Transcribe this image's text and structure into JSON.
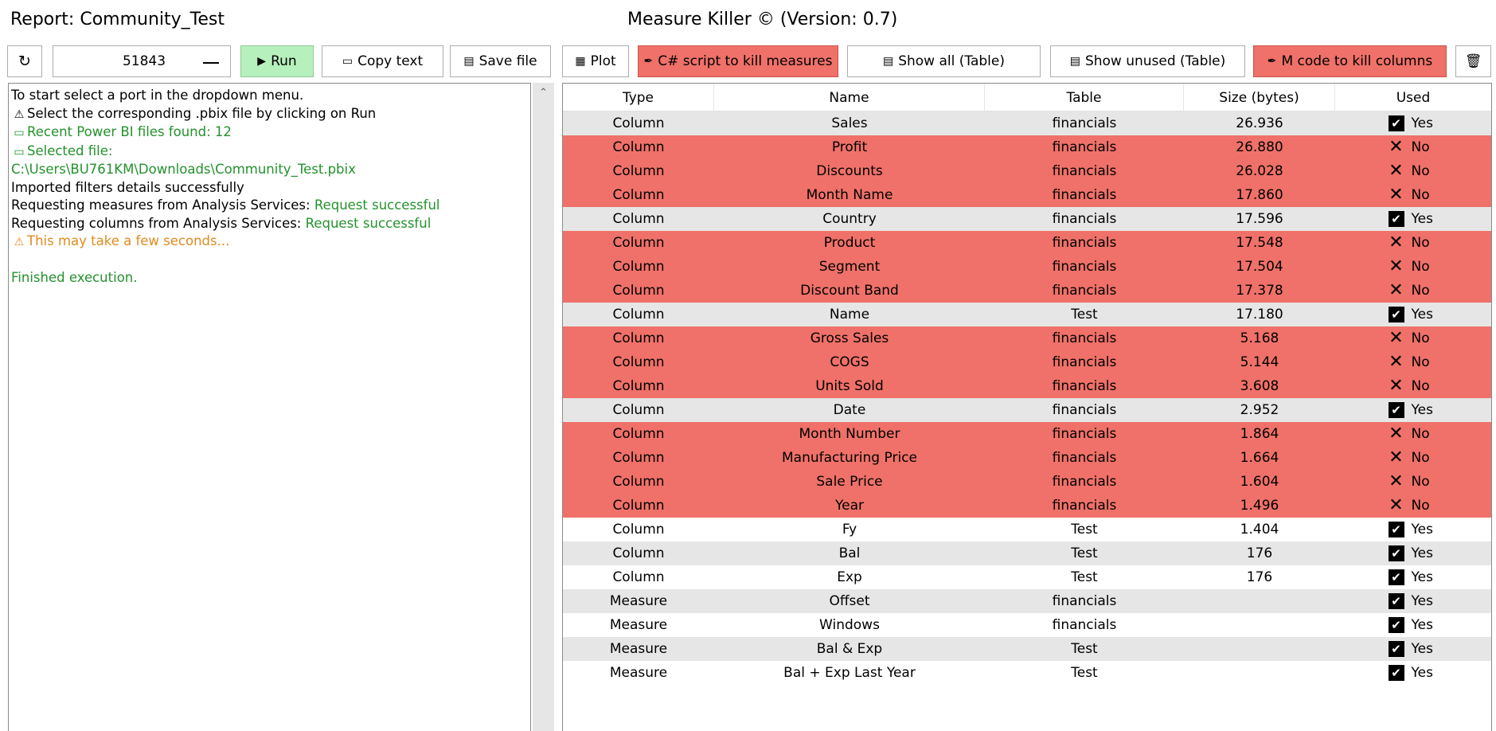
{
  "header": {
    "report_title": "Report: Community_Test",
    "app_title": "Measure Killer © (Version: 0.7)"
  },
  "toolbar": {
    "refresh_icon": "refresh-icon",
    "port_value": "51843",
    "run_label": "Run",
    "copy_label": "Copy text",
    "save_label": "Save file",
    "plot_label": "Plot",
    "csharp_label": "C# script to kill measures",
    "show_all_label": "Show all (Table)",
    "show_unused_label": "Show unused (Table)",
    "mcode_label": "M code to kill columns",
    "trash_icon": "trash-icon",
    "run_color": "#b6f0bc",
    "danger_color": "#ef7169"
  },
  "log": {
    "line1": "To start select a port in the dropdown menu.",
    "line2": "Select the corresponding .pbix file by clicking on Run",
    "line3": "Recent Power BI files found: 12",
    "line4": "Selected file:",
    "line5": "C:\\Users\\BU761KM\\Downloads\\Community_Test.pbix",
    "line6": "Imported filters details successfully",
    "line7_prefix": "Requesting measures from Analysis Services: ",
    "line7_status": "Request successful",
    "line8_prefix": "Requesting columns from Analysis Services: ",
    "line8_status": "Request successful",
    "line9": "This may take a few seconds...",
    "line10": "Finished execution."
  },
  "table": {
    "headers": {
      "type": "Type",
      "name": "Name",
      "table": "Table",
      "size": "Size (bytes)",
      "used": "Used"
    },
    "rows": [
      {
        "type": "Column",
        "name": "Sales",
        "table": "financials",
        "size": "26.936",
        "used": "Yes",
        "style": "grey"
      },
      {
        "type": "Column",
        "name": "Profit",
        "table": "financials",
        "size": "26.880",
        "used": "No",
        "style": "red"
      },
      {
        "type": "Column",
        "name": "Discounts",
        "table": "financials",
        "size": "26.028",
        "used": "No",
        "style": "red"
      },
      {
        "type": "Column",
        "name": "Month Name",
        "table": "financials",
        "size": "17.860",
        "used": "No",
        "style": "red"
      },
      {
        "type": "Column",
        "name": "Country",
        "table": "financials",
        "size": "17.596",
        "used": "Yes",
        "style": "grey"
      },
      {
        "type": "Column",
        "name": "Product",
        "table": "financials",
        "size": "17.548",
        "used": "No",
        "style": "red"
      },
      {
        "type": "Column",
        "name": "Segment",
        "table": "financials",
        "size": "17.504",
        "used": "No",
        "style": "red"
      },
      {
        "type": "Column",
        "name": "Discount Band",
        "table": "financials",
        "size": "17.378",
        "used": "No",
        "style": "red"
      },
      {
        "type": "Column",
        "name": "Name",
        "table": "Test",
        "size": "17.180",
        "used": "Yes",
        "style": "grey"
      },
      {
        "type": "Column",
        "name": "Gross Sales",
        "table": "financials",
        "size": "5.168",
        "used": "No",
        "style": "red"
      },
      {
        "type": "Column",
        "name": "COGS",
        "table": "financials",
        "size": "5.144",
        "used": "No",
        "style": "red"
      },
      {
        "type": "Column",
        "name": "Units Sold",
        "table": "financials",
        "size": "3.608",
        "used": "No",
        "style": "red"
      },
      {
        "type": "Column",
        "name": "Date",
        "table": "financials",
        "size": "2.952",
        "used": "Yes",
        "style": "grey"
      },
      {
        "type": "Column",
        "name": "Month Number",
        "table": "financials",
        "size": "1.864",
        "used": "No",
        "style": "red"
      },
      {
        "type": "Column",
        "name": "Manufacturing Price",
        "table": "financials",
        "size": "1.664",
        "used": "No",
        "style": "red"
      },
      {
        "type": "Column",
        "name": "Sale Price",
        "table": "financials",
        "size": "1.604",
        "used": "No",
        "style": "red"
      },
      {
        "type": "Column",
        "name": "Year",
        "table": "financials",
        "size": "1.496",
        "used": "No",
        "style": "red"
      },
      {
        "type": "Column",
        "name": "Fy",
        "table": "Test",
        "size": "1.404",
        "used": "Yes",
        "style": "white"
      },
      {
        "type": "Column",
        "name": "Bal",
        "table": "Test",
        "size": "176",
        "used": "Yes",
        "style": "grey"
      },
      {
        "type": "Column",
        "name": "Exp",
        "table": "Test",
        "size": "176",
        "used": "Yes",
        "style": "white"
      },
      {
        "type": "Measure",
        "name": "Offset",
        "table": "financials",
        "size": "",
        "used": "Yes",
        "style": "grey"
      },
      {
        "type": "Measure",
        "name": "Windows",
        "table": "financials",
        "size": "",
        "used": "Yes",
        "style": "white"
      },
      {
        "type": "Measure",
        "name": "Bal & Exp",
        "table": "Test",
        "size": "",
        "used": "Yes",
        "style": "grey"
      },
      {
        "type": "Measure",
        "name": "Bal + Exp Last Year",
        "table": "Test",
        "size": "",
        "used": "Yes",
        "style": "white"
      }
    ]
  }
}
